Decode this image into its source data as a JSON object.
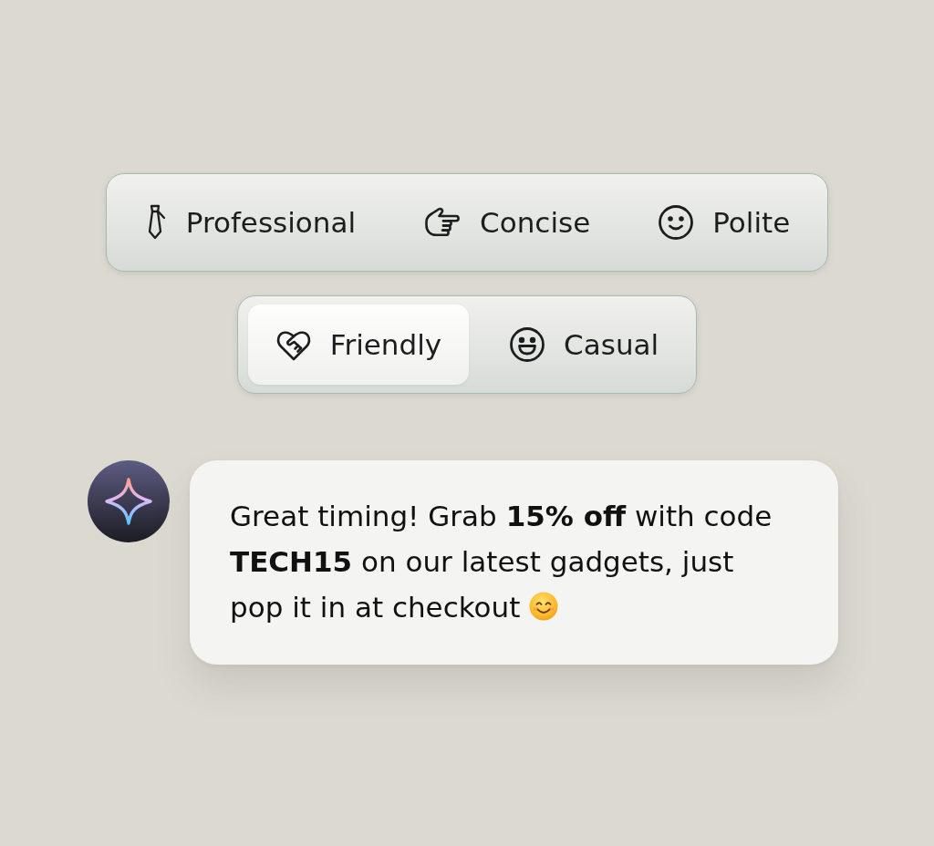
{
  "tone_groups": [
    {
      "options": [
        {
          "label": "Professional",
          "selected": false
        },
        {
          "label": "Concise",
          "selected": false
        },
        {
          "label": "Polite",
          "selected": false
        }
      ]
    },
    {
      "options": [
        {
          "label": "Friendly",
          "selected": true
        },
        {
          "label": "Casual",
          "selected": false
        }
      ]
    }
  ],
  "message": {
    "text": "Great timing! Grab **15% off** with code **TECH15** on our latest gadgets, just pop it in at checkout"
  }
}
